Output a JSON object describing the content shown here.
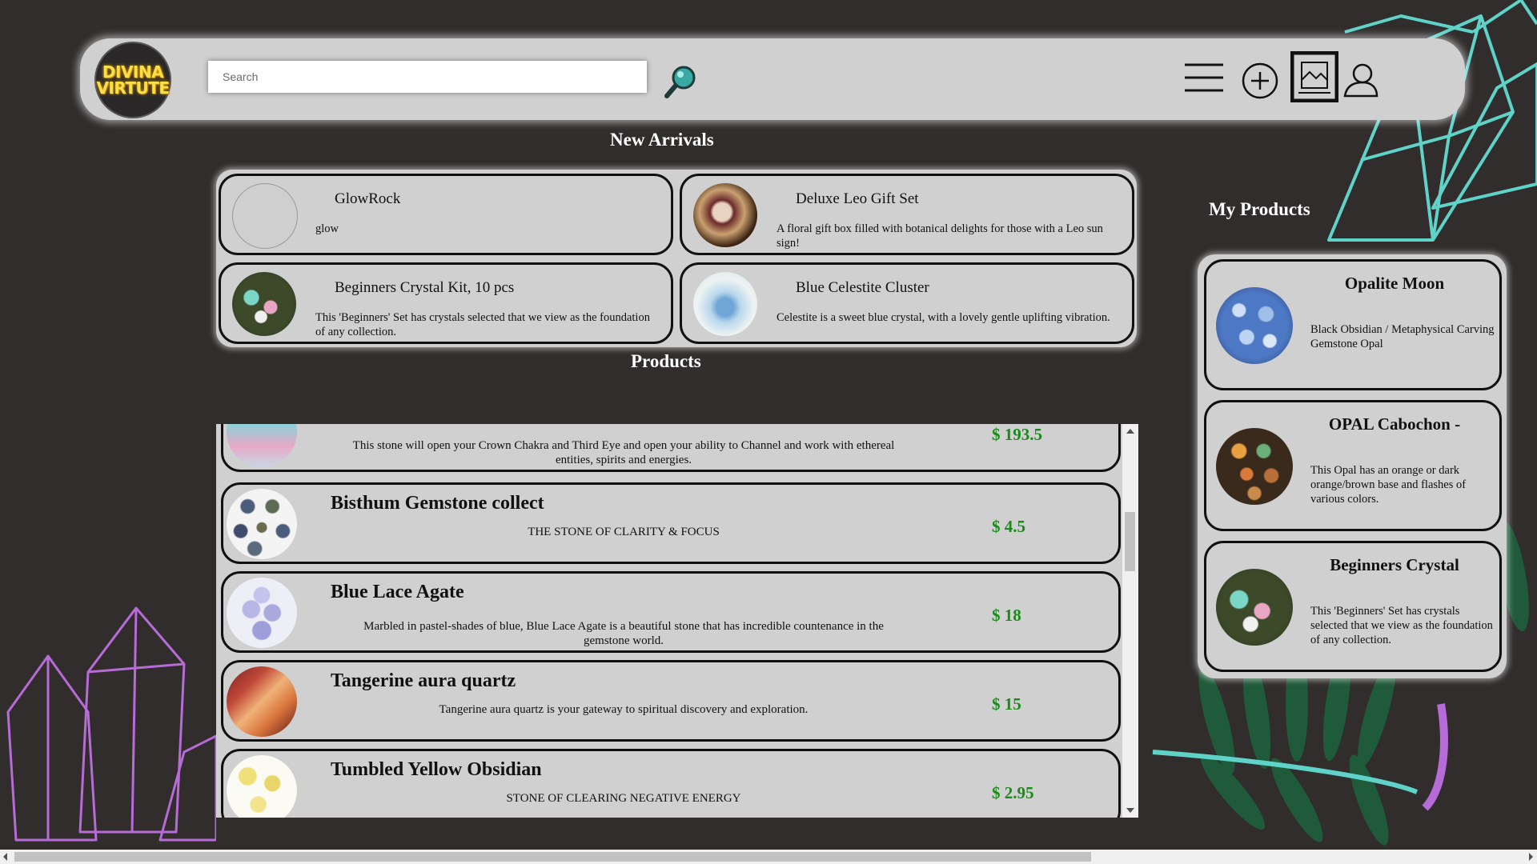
{
  "header": {
    "logo_line1": "DIVINA",
    "logo_line2": "VIRTUTE",
    "search_placeholder": "Search",
    "search_icon": "magnifier-icon",
    "menu_icon": "hamburger-menu-icon",
    "add_icon": "plus-circle-icon",
    "inventory_icon": "archive-box-icon",
    "account_icon": "user-icon"
  },
  "new_arrivals": {
    "title": "New Arrivals",
    "items": [
      {
        "name": "GlowRock",
        "desc": "glow",
        "image": "broken-image"
      },
      {
        "name": "Deluxe Leo Gift Set",
        "desc": "A floral gift box filled with botanical delights for those with a Leo sun sign!",
        "image": "gift-set-photo"
      },
      {
        "name": "Beginners Crystal Kit, 10 pcs",
        "desc": "This 'Beginners' Set has crystals selected that we view as the foundation of any collection.",
        "image": "crystal-kit-photo"
      },
      {
        "name": "Blue Celestite Cluster",
        "desc": "Celestite is a sweet blue crystal, with a lovely gentle uplifting vibration.",
        "image": "celestite-photo"
      }
    ]
  },
  "products": {
    "title": "Products",
    "items": [
      {
        "name": "",
        "desc": "This stone will open your Crown Chakra and Third Eye and open your ability to Channel and work with ethereal entities, spirits and energies.",
        "price": "$ 193.5"
      },
      {
        "name": "Bisthum Gemstone collect",
        "desc": "THE STONE OF CLARITY & FOCUS",
        "price": "$ 4.5"
      },
      {
        "name": "Blue Lace Agate",
        "desc": "Marbled in pastel-shades of blue, Blue Lace Agate is a beautiful stone that has incredible countenance in the gemstone world.",
        "price": "$ 18"
      },
      {
        "name": "Tangerine aura quartz",
        "desc": "Tangerine aura quartz is your gateway to spiritual discovery and exploration.",
        "price": "$ 15"
      },
      {
        "name": "Tumbled Yellow Obsidian",
        "desc": "STONE OF CLEARING NEGATIVE ENERGY",
        "price": "$ 2.95"
      }
    ]
  },
  "my_products": {
    "title": "My Products",
    "items": [
      {
        "name": "Opalite Moon",
        "desc": "Black Obsidian / Metaphysical Carving Gemstone Opal"
      },
      {
        "name": "OPAL Cabochon -",
        "desc": "This Opal has an orange or dark orange/brown base and flashes of various colors."
      },
      {
        "name": "Beginners Crystal",
        "desc": "This 'Beginners' Set has crystals selected that we view as the foundation of any collection."
      }
    ]
  },
  "colors": {
    "background": "#312d2d",
    "panel": "#d0d0d0",
    "price": "#1a8a1a",
    "teal_decoration": "#5fd3c8",
    "purple_decoration": "#b66bd6",
    "leaf": "#1f5a3a"
  }
}
